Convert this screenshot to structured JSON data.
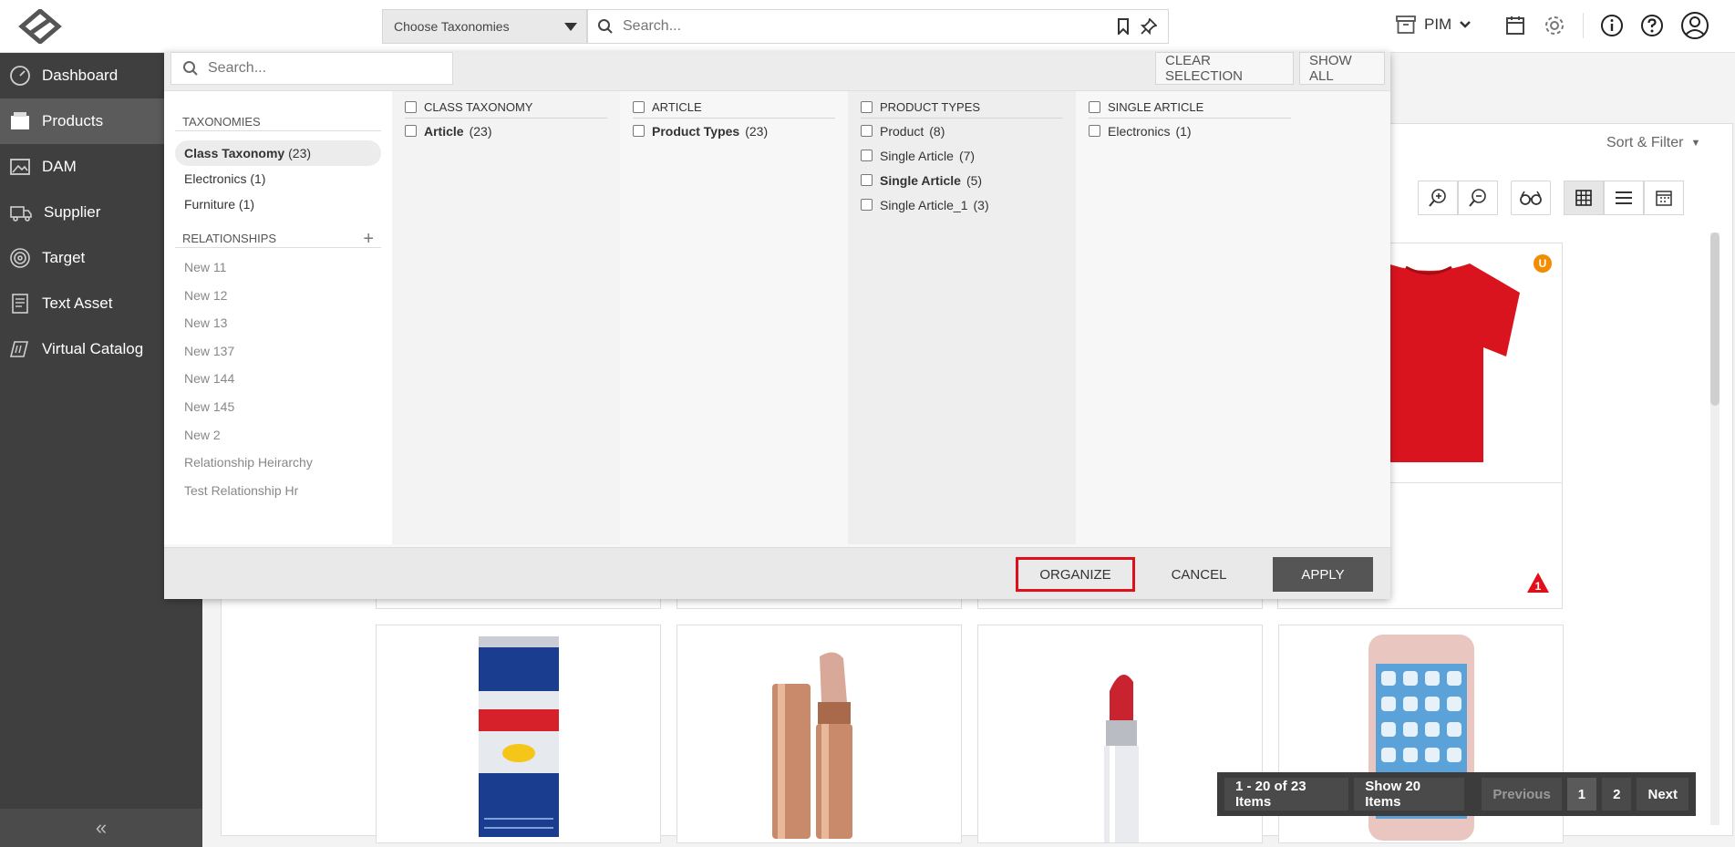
{
  "header": {
    "taxonomy_select": "Choose Taxonomies",
    "search_placeholder": "Search...",
    "module_label": "PIM"
  },
  "sidebar": {
    "items": [
      {
        "label": "Dashboard",
        "icon": "dashboard-icon"
      },
      {
        "label": "Products",
        "icon": "products-icon"
      },
      {
        "label": "DAM",
        "icon": "image-icon"
      },
      {
        "label": "Supplier",
        "icon": "truck-icon"
      },
      {
        "label": "Target",
        "icon": "target-icon"
      },
      {
        "label": "Text Asset",
        "icon": "document-icon"
      },
      {
        "label": "Virtual Catalog",
        "icon": "catalog-icon"
      }
    ],
    "collapse_label": "«"
  },
  "content": {
    "sort_filter": "Sort & Filter",
    "badge_u": "U",
    "badge_warning": "1",
    "pagination": {
      "range": "1 - 20 of 23 Items",
      "page_size": "Show 20 Items",
      "previous": "Previous",
      "pages": [
        "1",
        "2"
      ],
      "next": "Next"
    }
  },
  "panel": {
    "search_placeholder": "Search...",
    "clear_selection": "CLEAR SELECTION",
    "show_all": "SHOW ALL",
    "taxonomies_header": "TAXONOMIES",
    "taxonomies": [
      {
        "label": "Class Taxonomy",
        "count": "(23)"
      },
      {
        "label": "Electronics",
        "count": "(1)"
      },
      {
        "label": "Furniture",
        "count": "(1)"
      }
    ],
    "relationships_header": "RELATIONSHIPS",
    "relationships": [
      "New 11",
      "New 12",
      "New 13",
      "New 137",
      "New 144",
      "New 145",
      "New 2",
      "Relationship Heirarchy",
      "Test Relationship Hr"
    ],
    "columns": [
      {
        "header": "CLASS TAXONOMY",
        "rows": [
          {
            "label": "Article",
            "count": "(23)"
          }
        ]
      },
      {
        "header": "ARTICLE",
        "rows": [
          {
            "label": "Product Types",
            "count": "(23)"
          }
        ]
      },
      {
        "header": "PRODUCT TYPES",
        "rows": [
          {
            "label": "Product",
            "count": "(8)"
          },
          {
            "label": "Single Article",
            "count": "(7)"
          },
          {
            "label": "Single Article",
            "count": "(5)"
          },
          {
            "label": "Single Article_1",
            "count": "(3)"
          }
        ]
      },
      {
        "header": "SINGLE ARTICLE",
        "rows": [
          {
            "label": "Electronics",
            "count": "(1)"
          }
        ]
      }
    ],
    "footer": {
      "organize": "ORGANIZE",
      "cancel": "CANCEL",
      "apply": "APPLY"
    }
  },
  "colors": {
    "sidebar_bg": "#3f3f3f",
    "sidebar_active": "#5b5b5b",
    "highlight_border": "#e0101a",
    "badge_orange": "#f28c00",
    "warning_red": "#e0101a"
  }
}
